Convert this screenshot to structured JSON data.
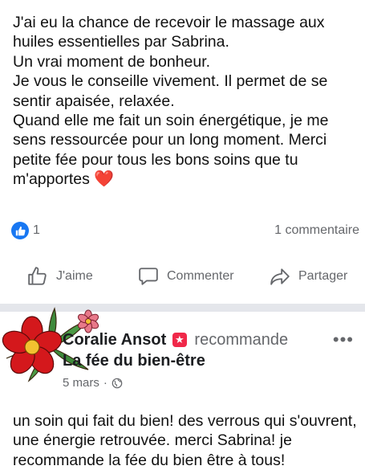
{
  "post": {
    "lines": [
      "J'ai eu la chance de recevoir le massage aux huiles essentielles par Sabrina.",
      "Un vrai moment de bonheur.",
      "Je vous le conseille vivement. Il permet de se sentir apaisée, relaxée.",
      "Quand elle me fait un soin énergétique,  je me sens ressourcée pour un long moment. Merci petite fée pour tous les bons soins que tu m'apportes"
    ],
    "emoji": "❤️"
  },
  "reactions": {
    "like_count": "1",
    "comment_count": "1 commentaire"
  },
  "actions": {
    "like": "J'aime",
    "comment": "Commenter",
    "share": "Partager"
  },
  "review": {
    "author": "Coralie Ansot",
    "recommends": "recommande",
    "page": "La fée du bien-être",
    "date": "5 mars",
    "separator": "·",
    "more": "•••",
    "text": "un soin qui fait du bien! des verrous qui s'ouvrent, une énergie retrouvée. merci Sabrina! je recommande la fée du bien être à tous!"
  },
  "colors": {
    "facebook_blue": "#1877f2",
    "recommend_red": "#f02849",
    "muted_gray": "#65676b",
    "separator": "#e4e6eb"
  },
  "icons": {
    "like_bubble": "thumbs-up-icon",
    "like_action": "thumbs-up-outline-icon",
    "comment_action": "speech-bubble-icon",
    "share_action": "share-arrow-icon",
    "privacy": "globe-icon",
    "recommend": "star-badge-icon",
    "more": "ellipsis-icon"
  }
}
